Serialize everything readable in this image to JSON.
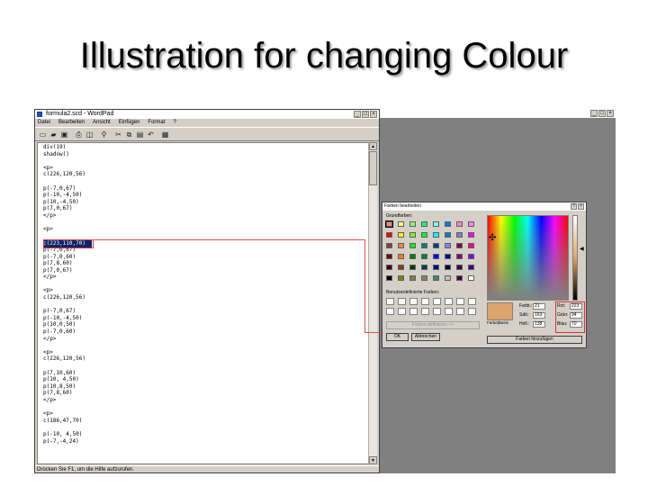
{
  "slide": {
    "title": "Illustration for changing Colour"
  },
  "wordpad": {
    "title": "formula2.scd - WordPad",
    "menu": [
      "Datei",
      "Bearbeiten",
      "Ansicht",
      "Einfügen",
      "Format",
      "?"
    ],
    "toolbar_icons": [
      "new-document-icon",
      "open-folder-icon",
      "save-icon",
      "print-icon",
      "print-preview-icon",
      "find-icon",
      "cut-icon",
      "copy-icon",
      "paste-icon",
      "undo-icon",
      "date-time-icon"
    ],
    "code_lines": [
      "div(19)",
      "shadow()",
      "",
      "<p>",
      "c(226,120,56)",
      "",
      "p(-7,0,67)",
      "p(-10,-4,50)",
      "p(10,-4,50)",
      "p(7,0,67)",
      "</p>",
      "",
      "<p>",
      "",
      "",
      "p(-7,0,67)",
      "p(-7,0,60)",
      "p(7,8,60)",
      "p(7,0,67)",
      "</p>",
      "",
      "<p>",
      "c(226,120,56)",
      "",
      "p(-7,0,67)",
      "p(-10,-4,50)",
      "p(10,0,50)",
      "p(-7,0,60)",
      "</p>",
      "",
      "<p>",
      "c(226,120,56)",
      "",
      "p(7,10,60)",
      "p(10, 4,50)",
      "p(10,8,50)",
      "p(7,8,60)",
      "</p>",
      "",
      "<p>",
      "c(186,47,70)",
      "",
      "p(-10, 4,50)",
      "p(-7,-4,24)"
    ],
    "highlighted": "c(223,110,70)",
    "status": "Drücken Sie F1, um die Hilfe aufzurufen."
  },
  "dialog": {
    "title": "Farben bearbeiten",
    "basic_label": "Grundfarben:",
    "custom_label": "Benutzerdefinierte Farben:",
    "define_btn": "Farben definieren >>",
    "ok_btn": "OK",
    "cancel_btn": "Abbrechen",
    "add_btn": "Farben hinzufügen",
    "colorsolid_label": "Farbe|Basis",
    "hue_label": "Farbt.:",
    "hue_value": "21",
    "sat_label": "Sätt.:",
    "sat_value": "163",
    "lum_label": "Hell.:",
    "lum_value": "138",
    "red_label": "Rot:",
    "red_value": "223",
    "green_label": "Grün:",
    "green_value": "94",
    "blue_label": "Blau:",
    "blue_value": "70",
    "basic_colors": [
      "#ff8080",
      "#ffff80",
      "#80ff80",
      "#00ff80",
      "#80ffff",
      "#0080ff",
      "#ff80c0",
      "#ff80ff",
      "#ff0000",
      "#ffff00",
      "#80ff00",
      "#00ff40",
      "#00ffff",
      "#0080c0",
      "#8080c0",
      "#ff00ff",
      "#804040",
      "#ff8040",
      "#00ff00",
      "#008080",
      "#004080",
      "#8080ff",
      "#800040",
      "#ff0080",
      "#800000",
      "#ff8000",
      "#008000",
      "#008040",
      "#0000ff",
      "#0000a0",
      "#800080",
      "#8000ff",
      "#400000",
      "#804000",
      "#004000",
      "#004040",
      "#000080",
      "#000040",
      "#400040",
      "#400080",
      "#000000",
      "#808000",
      "#808040",
      "#808080",
      "#408080",
      "#c0c0c0",
      "#400040",
      "#ffffff"
    ],
    "preview_color": "#dea46e"
  }
}
